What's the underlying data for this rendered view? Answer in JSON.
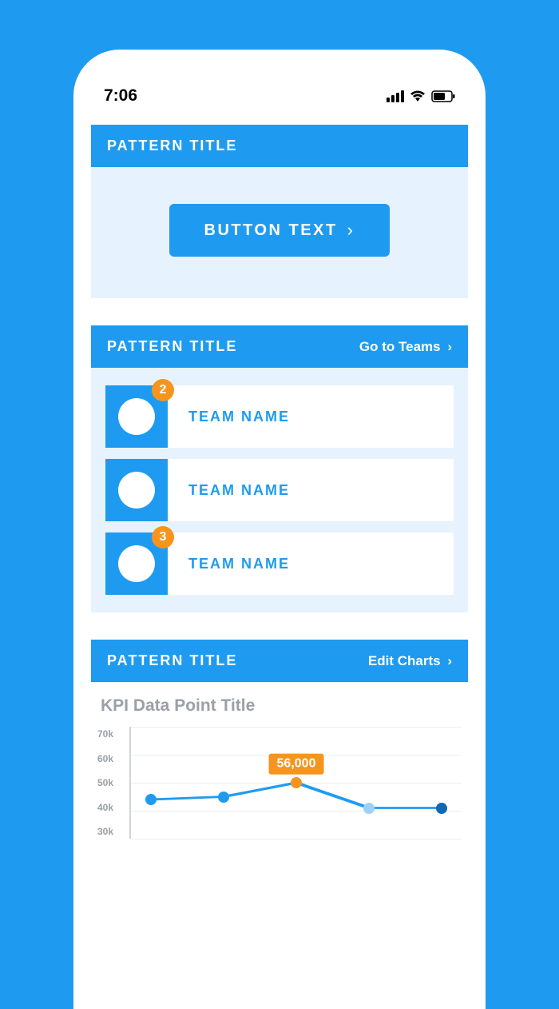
{
  "statusbar": {
    "time": "7:06"
  },
  "card1": {
    "title": "PATTERN TITLE",
    "button_label": "BUTTON TEXT"
  },
  "card2": {
    "title": "PATTERN TITLE",
    "link_label": "Go to Teams",
    "teams": [
      {
        "name": "TEAM NAME",
        "badge": "2"
      },
      {
        "name": "TEAM NAME",
        "badge": null
      },
      {
        "name": "TEAM NAME",
        "badge": "3"
      }
    ]
  },
  "card3": {
    "title": "PATTERN TITLE",
    "link_label": "Edit Charts",
    "kpi_title": "KPI Data Point Title",
    "callout": "56,000"
  },
  "chart_data": {
    "type": "line",
    "title": "KPI Data Point Title",
    "ylabel": "",
    "xlabel": "",
    "ylim": [
      30000,
      70000
    ],
    "yticks": [
      "70k",
      "60k",
      "50k",
      "40k",
      "30k"
    ],
    "x": [
      1,
      2,
      3,
      4,
      5
    ],
    "values": [
      44000,
      45000,
      50000,
      41000,
      41000
    ],
    "highlight_index": 2,
    "highlight_label": "56,000"
  }
}
